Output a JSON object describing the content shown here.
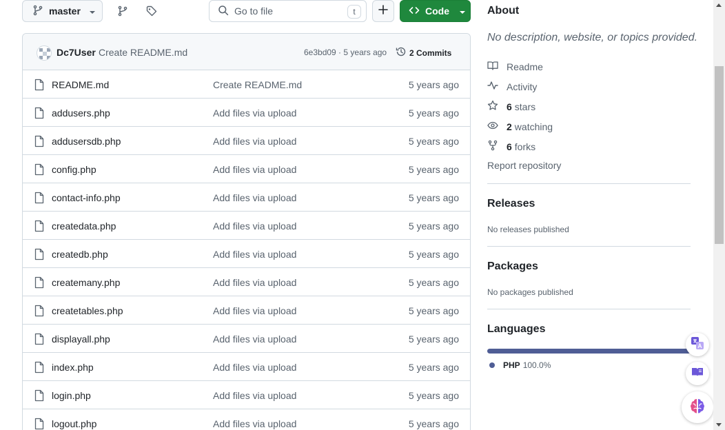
{
  "toolbar": {
    "branch": "master",
    "search_placeholder": "Go to file",
    "search_shortcut": "t",
    "code_label": "Code"
  },
  "commit": {
    "author": "Dc7User",
    "message": "Create README.md",
    "meta": "6e3bd09 · 5 years ago",
    "commits_count": "2 Commits"
  },
  "files": [
    {
      "name": "README.md",
      "message": "Create README.md",
      "age": "5 years ago"
    },
    {
      "name": "addusers.php",
      "message": "Add files via upload",
      "age": "5 years ago"
    },
    {
      "name": "addusersdb.php",
      "message": "Add files via upload",
      "age": "5 years ago"
    },
    {
      "name": "config.php",
      "message": "Add files via upload",
      "age": "5 years ago"
    },
    {
      "name": "contact-info.php",
      "message": "Add files via upload",
      "age": "5 years ago"
    },
    {
      "name": "createdata.php",
      "message": "Add files via upload",
      "age": "5 years ago"
    },
    {
      "name": "createdb.php",
      "message": "Add files via upload",
      "age": "5 years ago"
    },
    {
      "name": "createmany.php",
      "message": "Add files via upload",
      "age": "5 years ago"
    },
    {
      "name": "createtables.php",
      "message": "Add files via upload",
      "age": "5 years ago"
    },
    {
      "name": "displayall.php",
      "message": "Add files via upload",
      "age": "5 years ago"
    },
    {
      "name": "index.php",
      "message": "Add files via upload",
      "age": "5 years ago"
    },
    {
      "name": "login.php",
      "message": "Add files via upload",
      "age": "5 years ago"
    },
    {
      "name": "logout.php",
      "message": "Add files via upload",
      "age": "5 years ago"
    }
  ],
  "about": {
    "title": "About",
    "description": "No description, website, or topics provided.",
    "readme": "Readme",
    "activity": "Activity",
    "stars_count": "6",
    "stars_label": "stars",
    "watching_count": "2",
    "watching_label": "watching",
    "forks_count": "6",
    "forks_label": "forks",
    "report": "Report repository"
  },
  "releases": {
    "title": "Releases",
    "empty": "No releases published"
  },
  "packages": {
    "title": "Packages",
    "empty": "No packages published"
  },
  "languages": {
    "title": "Languages",
    "items": [
      {
        "name": "PHP",
        "percent": "100.0%",
        "color": "#4f5d95"
      }
    ]
  },
  "colors": {
    "accent_green": "#1f883d",
    "border": "#d1d9e0",
    "muted": "#59636e"
  }
}
